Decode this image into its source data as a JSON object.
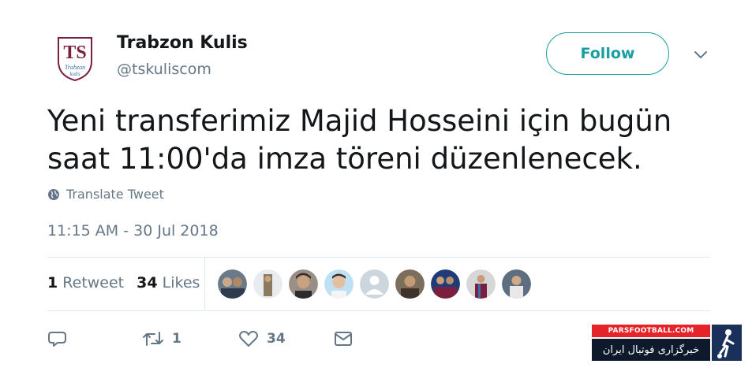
{
  "header": {
    "avatar_logo_text": "TS",
    "avatar_logo_subtext": "Trabzon kulis",
    "name": "Trabzon Kulis",
    "handle": "@tskuliscom",
    "follow_label": "Follow"
  },
  "tweet": {
    "line1": "Yeni transferimiz Majid Hosseini için bugün",
    "line2": "saat 11:00'da imza töreni düzenlenecek.",
    "translate_label": "Translate Tweet",
    "timestamp": "11:15 AM - 30 Jul 2018"
  },
  "stats": {
    "retweet_count": "1",
    "retweet_label": "Retweet",
    "likes_count": "34",
    "likes_label": "Likes"
  },
  "actions": {
    "retweet_count": "1",
    "like_count": "34"
  },
  "watermark": {
    "top_text": "PARSFOOTBALL.COM",
    "bottom_text": "خبرگزاری فوتبال ایران"
  },
  "colors": {
    "accent": "#1a9ea0",
    "text": "#14171a",
    "muted": "#657786",
    "divider": "#e1e8ed"
  }
}
